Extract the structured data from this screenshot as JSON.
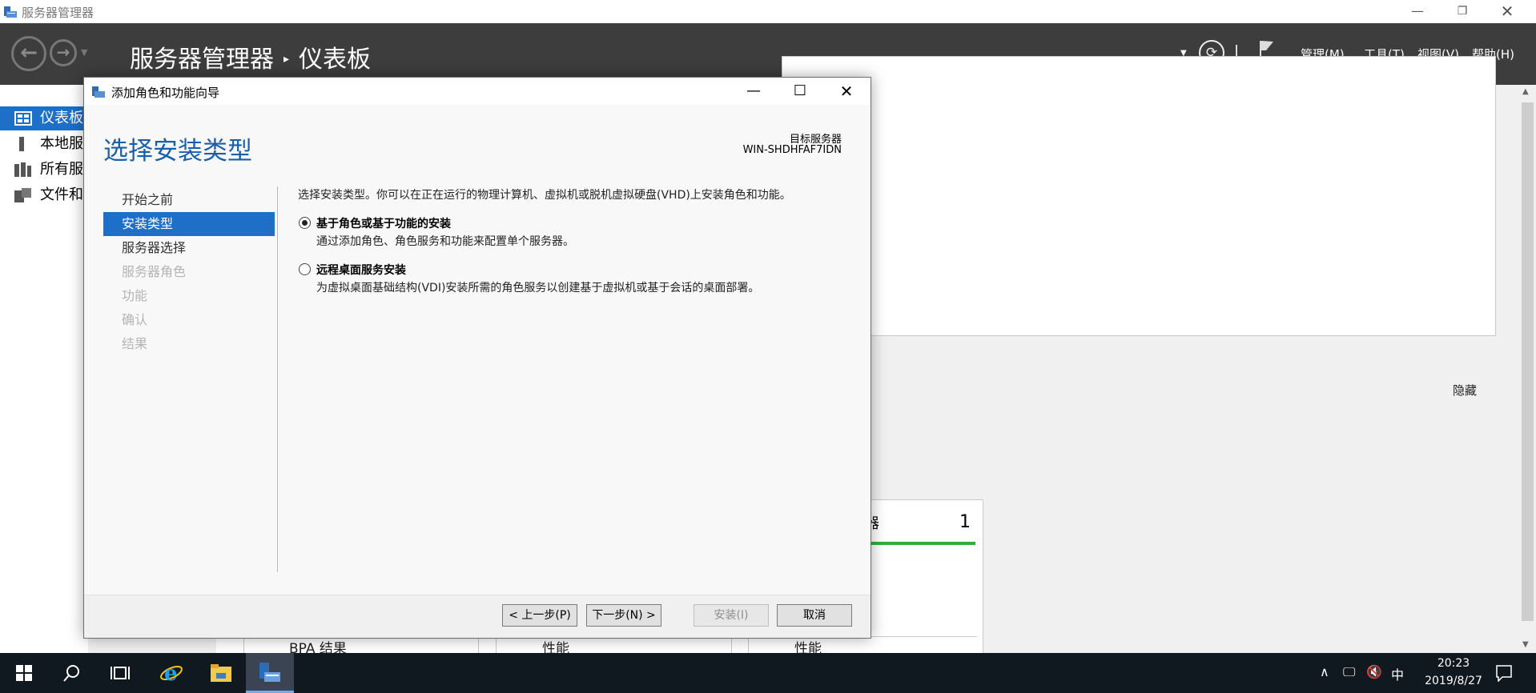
{
  "window": {
    "title": "服务器管理器",
    "minimize_icon": "minimize-icon",
    "restore_icon": "restore-icon",
    "close_icon": "close-icon"
  },
  "header": {
    "breadcrumb_root": "服务器管理器",
    "breadcrumb_separator": "▸",
    "breadcrumb_current": "仪表板",
    "menus": [
      "管理(M)",
      "工具(T)",
      "视图(V)",
      "帮助(H)"
    ]
  },
  "sidebar": {
    "items": [
      {
        "label": "仪表板",
        "icon": "dashboard-icon",
        "active": true
      },
      {
        "label": "本地服务器",
        "icon": "local-server-icon",
        "active": false
      },
      {
        "label": "所有服务器",
        "icon": "all-servers-icon",
        "active": false
      },
      {
        "label": "文件和存储服务",
        "icon": "file-storage-icon",
        "active": false
      }
    ]
  },
  "main": {
    "hide_link": "隐藏",
    "server_tile_count": "1",
    "server_tile_partial_label": "器",
    "bottom_row": [
      "BPA 结果",
      "性能",
      "性能"
    ]
  },
  "wizard": {
    "title": "添加角色和功能向导",
    "heading": "选择安装类型",
    "destination_label": "目标服务器",
    "destination_value": "WIN-SHDHFAF7IDN",
    "steps": [
      {
        "label": "开始之前",
        "state": "normal"
      },
      {
        "label": "安装类型",
        "state": "active"
      },
      {
        "label": "服务器选择",
        "state": "normal"
      },
      {
        "label": "服务器角色",
        "state": "disabled"
      },
      {
        "label": "功能",
        "state": "disabled"
      },
      {
        "label": "确认",
        "state": "disabled"
      },
      {
        "label": "结果",
        "state": "disabled"
      }
    ],
    "intro": "选择安装类型。你可以在正在运行的物理计算机、虚拟机或脱机虚拟硬盘(VHD)上安装角色和功能。",
    "options": [
      {
        "title": "基于角色或基于功能的安装",
        "desc": "通过添加角色、角色服务和功能来配置单个服务器。",
        "selected": true
      },
      {
        "title": "远程桌面服务安装",
        "desc": "为虚拟桌面基础结构(VDI)安装所需的角色服务以创建基于虚拟机或基于会话的桌面部署。",
        "selected": false
      }
    ],
    "buttons": {
      "previous": "< 上一步(P)",
      "next": "下一步(N) >",
      "install": "安装(I)",
      "cancel": "取消"
    }
  },
  "taskbar": {
    "ime": "中",
    "time": "20:23",
    "date": "2019/8/27"
  },
  "colors": {
    "accent": "#1e6fc7",
    "header_bg": "#3d3d3d",
    "heading_blue": "#1b5fa8",
    "status_green": "#2db13a",
    "taskbar_bg": "#101820"
  }
}
